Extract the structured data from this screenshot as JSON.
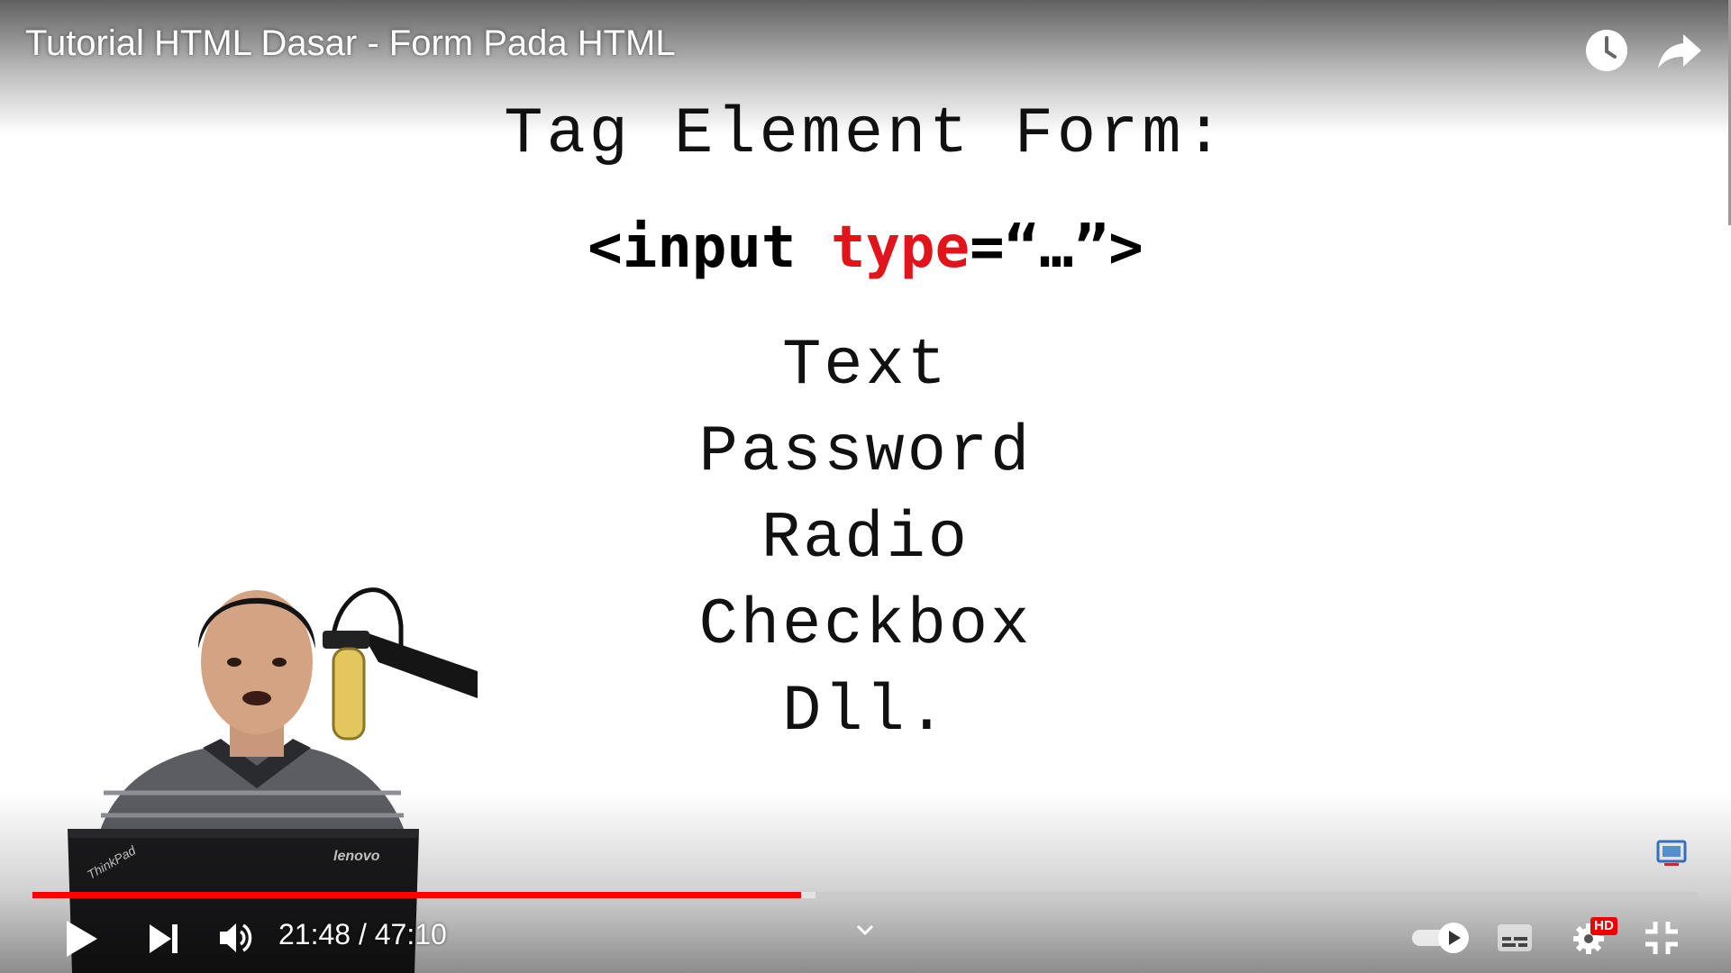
{
  "video": {
    "title": "Tutorial HTML Dasar - Form Pada HTML"
  },
  "slide": {
    "heading": "Tag Element Form:",
    "code": {
      "open": "<input ",
      "keyword": "type",
      "rest": "=“…”>"
    },
    "types": [
      "Text",
      "Password",
      "Radio",
      "Checkbox",
      "Dll."
    ]
  },
  "player": {
    "current_time": "21:48",
    "separator": " / ",
    "duration": "47:10",
    "progress_played": 0.4617,
    "accent_color": "#ff0000",
    "hd_badge": "HD",
    "icons": {
      "watch_later": "clock-icon",
      "share": "share-arrow-icon",
      "play": "play-icon",
      "next": "skip-next-icon",
      "volume": "volume-icon",
      "chapters": "chevron-down-icon",
      "autoplay": "autoplay-toggle-icon",
      "subtitles": "subtitles-icon",
      "settings": "gear-icon",
      "fullscreen_exit": "fullscreen-exit-icon"
    }
  }
}
